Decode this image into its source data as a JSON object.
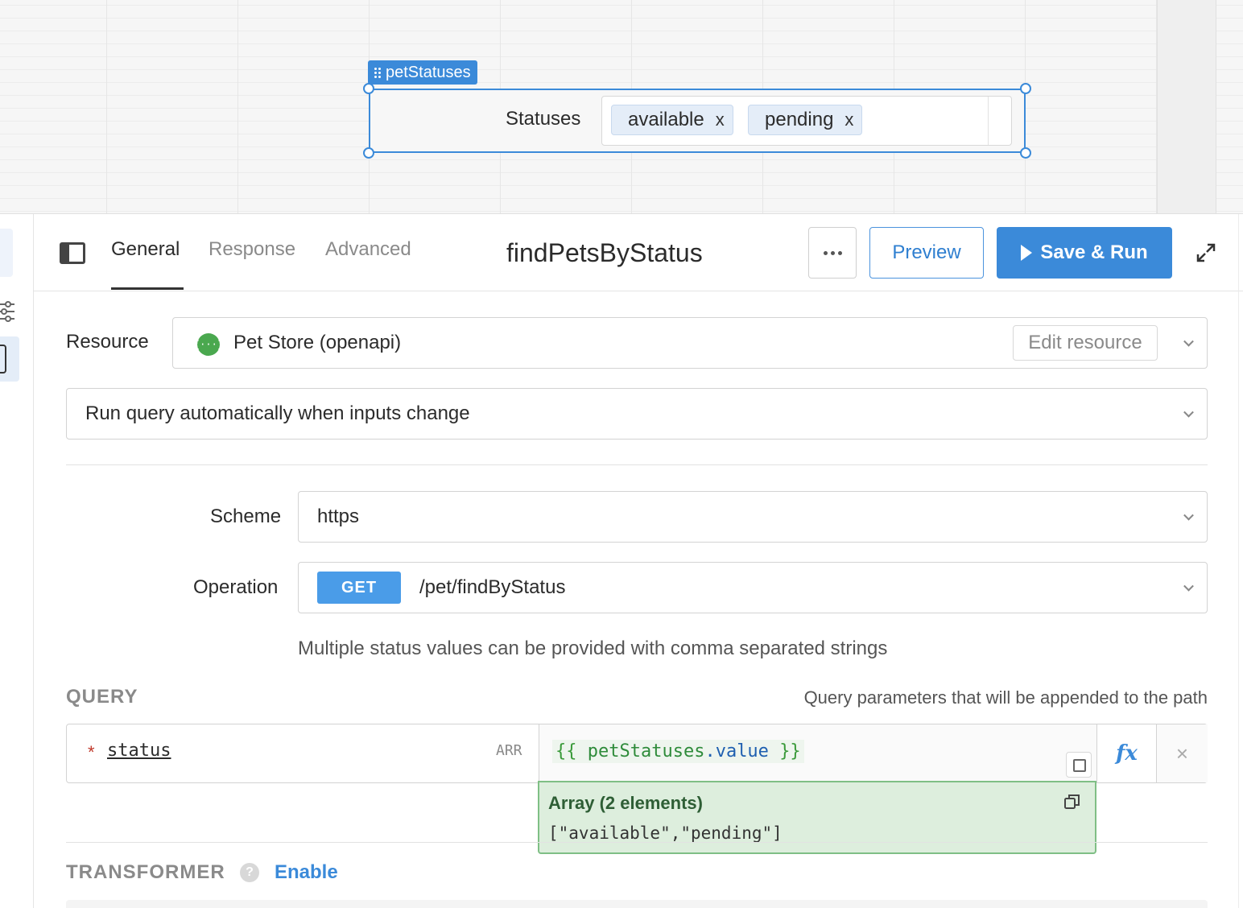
{
  "canvas": {
    "component_name": "petStatuses",
    "statuses_label": "Statuses",
    "chips": [
      "available",
      "pending"
    ],
    "chip_remove": "x"
  },
  "header": {
    "tabs": [
      "General",
      "Response",
      "Advanced"
    ],
    "active_tab": "General",
    "query_name": "findPetsByStatus",
    "preview_label": "Preview",
    "save_run_label": "Save & Run"
  },
  "resource": {
    "label": "Resource",
    "value": "Pet Store (openapi)",
    "icon_text": "{···}",
    "edit_label": "Edit resource"
  },
  "run_mode": {
    "value": "Run query automatically when inputs change"
  },
  "scheme": {
    "label": "Scheme",
    "value": "https"
  },
  "operation": {
    "label": "Operation",
    "method": "GET",
    "path": "/pet/findByStatus",
    "hint": "Multiple status values can be provided with comma separated strings"
  },
  "query": {
    "heading": "QUERY",
    "hint": "Query parameters that will be appended to the path",
    "params": [
      {
        "required_mark": "*",
        "key": "status",
        "type": "ARR",
        "value_open": "{{",
        "value_ident": "petStatuses",
        "value_prop": ".value",
        "value_close": "}}",
        "fx": "fx",
        "remove": "×"
      }
    ]
  },
  "eval": {
    "title": "Array (2 elements)",
    "value": "[\"available\",\"pending\"]"
  },
  "transformer": {
    "heading": "TRANSFORMER",
    "help": "?",
    "enable_label": "Enable"
  },
  "colors": {
    "accent": "#3b8ad9",
    "get_badge": "#4a9ce8",
    "eval_bg": "#ddeedd",
    "eval_border": "#7fbf85",
    "resource_icon": "#4aa84f"
  },
  "icons": [
    "grip-icon",
    "sidebar-toggle-icon",
    "more-icon",
    "play-icon",
    "expand-icon",
    "chevron-down-icon",
    "copy-icon",
    "help-icon",
    "settings-sliders-icon"
  ]
}
